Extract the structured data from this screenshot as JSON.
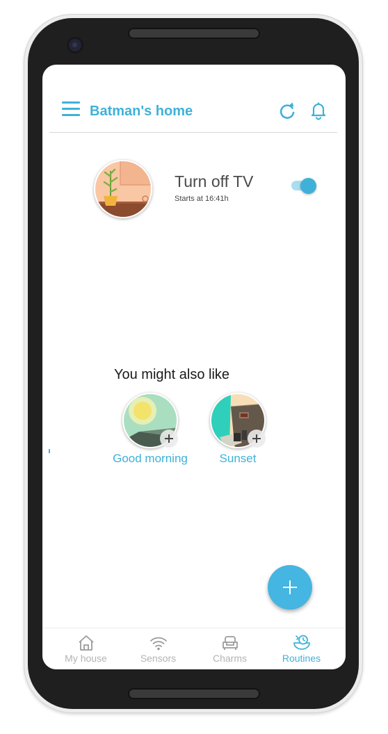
{
  "header": {
    "title": "Batman's home",
    "menu_icon": "menu-icon",
    "refresh_icon": "refresh-icon",
    "notifications_icon": "bell-icon"
  },
  "routine": {
    "name": "Turn off TV",
    "schedule": "Starts at 16:41h",
    "enabled": true
  },
  "suggestions": {
    "title": "You might also like",
    "items": [
      {
        "label": "Good morning"
      },
      {
        "label": "Sunset"
      }
    ]
  },
  "fab": {
    "icon": "plus-icon"
  },
  "bottom_nav": {
    "items": [
      {
        "label": "My house",
        "icon": "house-icon",
        "active": false
      },
      {
        "label": "Sensors",
        "icon": "wifi-icon",
        "active": false
      },
      {
        "label": "Charms",
        "icon": "sofa-icon",
        "active": false
      },
      {
        "label": "Routines",
        "icon": "routines-icon",
        "active": true
      }
    ]
  },
  "colors": {
    "accent": "#3fb1d8",
    "inactive": "#b3b3b3",
    "fab": "#45b5e1"
  }
}
